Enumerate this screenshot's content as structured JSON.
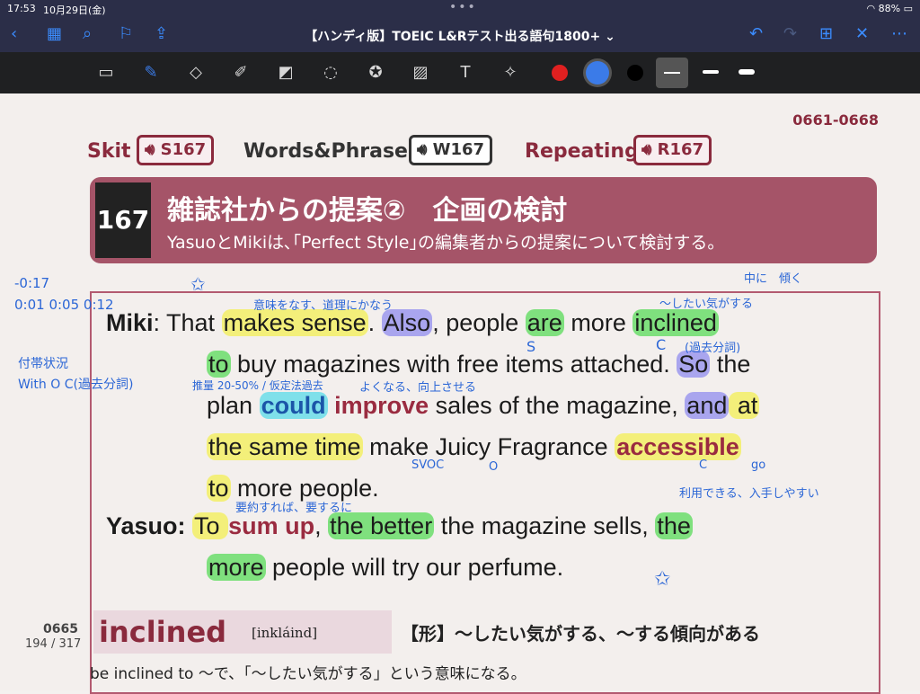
{
  "status": {
    "time": "17:53",
    "date": "10月29日(金)",
    "battery": "88%"
  },
  "nav": {
    "title": "【ハンディ版】TOEIC L&Rテスト出る語句1800+",
    "chevron": "⌄"
  },
  "toolbar": {
    "colors": [
      "#e02020",
      "#3b7be8",
      "#000000"
    ]
  },
  "page": {
    "page_id": "0661-0668",
    "skit_label": "Skit",
    "skit_code": "S167",
    "words_label": "Words&Phrases",
    "words_code": "W167",
    "repeat_label": "Repeating",
    "repeat_code": "R167",
    "unit_number": "167",
    "unit_title": "雑誌社からの提案②　企画の検討",
    "unit_subtitle": "YasuoとMikiは､｢Perfect Style｣の編集者からの提案について検討する。"
  },
  "dialog": {
    "speaker1": "Miki",
    "speaker2": "Yasuo:",
    "l1": {
      "colon": ": That ",
      "a": "makes sense",
      "b": ". ",
      "c": "Also",
      "d": ", people ",
      "e": "are",
      "f": " more ",
      "g": "inclined"
    },
    "l2": {
      "a": "to",
      "b": " buy magazines with free items attached. ",
      "c": "So",
      "d": " the"
    },
    "l3": {
      "a": "plan ",
      "b": "could",
      "c": " ",
      "d": "improve",
      "e": " sales of the magazine, ",
      "f": "and",
      "g": " at"
    },
    "l4": {
      "a": "the same time",
      "b": " make Juicy Fragrance ",
      "c": "accessible"
    },
    "l5": {
      "a": "to",
      "b": " more people."
    },
    "l6": {
      "a": "To ",
      "b": "sum up",
      "c": ", ",
      "d": "the better",
      "e": " the magazine sells, ",
      "f": "the"
    },
    "l7": {
      "a": "more",
      "b": " people will try our perfume."
    }
  },
  "annotations": {
    "times1": "-0:17",
    "times2": "0:01 0:05 0:12",
    "a_meaning": "意味をなす、道理にかなう",
    "a_naka": "中に　傾く",
    "a_shitai": "〜したい気がする",
    "a_kako": "(過去分詞)",
    "a_futai": "付帯状況",
    "a_with": "With O C(過去分詞)",
    "a_suiryo": "推量 20-50% / 仮定法過去",
    "a_yokunaru": "よくなる、向上させる",
    "a_svoc": "SVOC",
    "a_o": "O",
    "a_c": "C",
    "a_go": "go",
    "a_yoyaku": "要約すれば、要するに",
    "a_riyo": "利用できる、入手しやすい",
    "mark_s": "S",
    "mark_c": "C"
  },
  "vocab": {
    "number": "0665",
    "word": "inclined",
    "pron": "[inkláind]",
    "definition": "【形】〜したい気がする、〜する傾向がある",
    "note": "be inclined to 〜で、「〜したい気がする」という意味になる。",
    "page_indicator": "194 / 317"
  }
}
